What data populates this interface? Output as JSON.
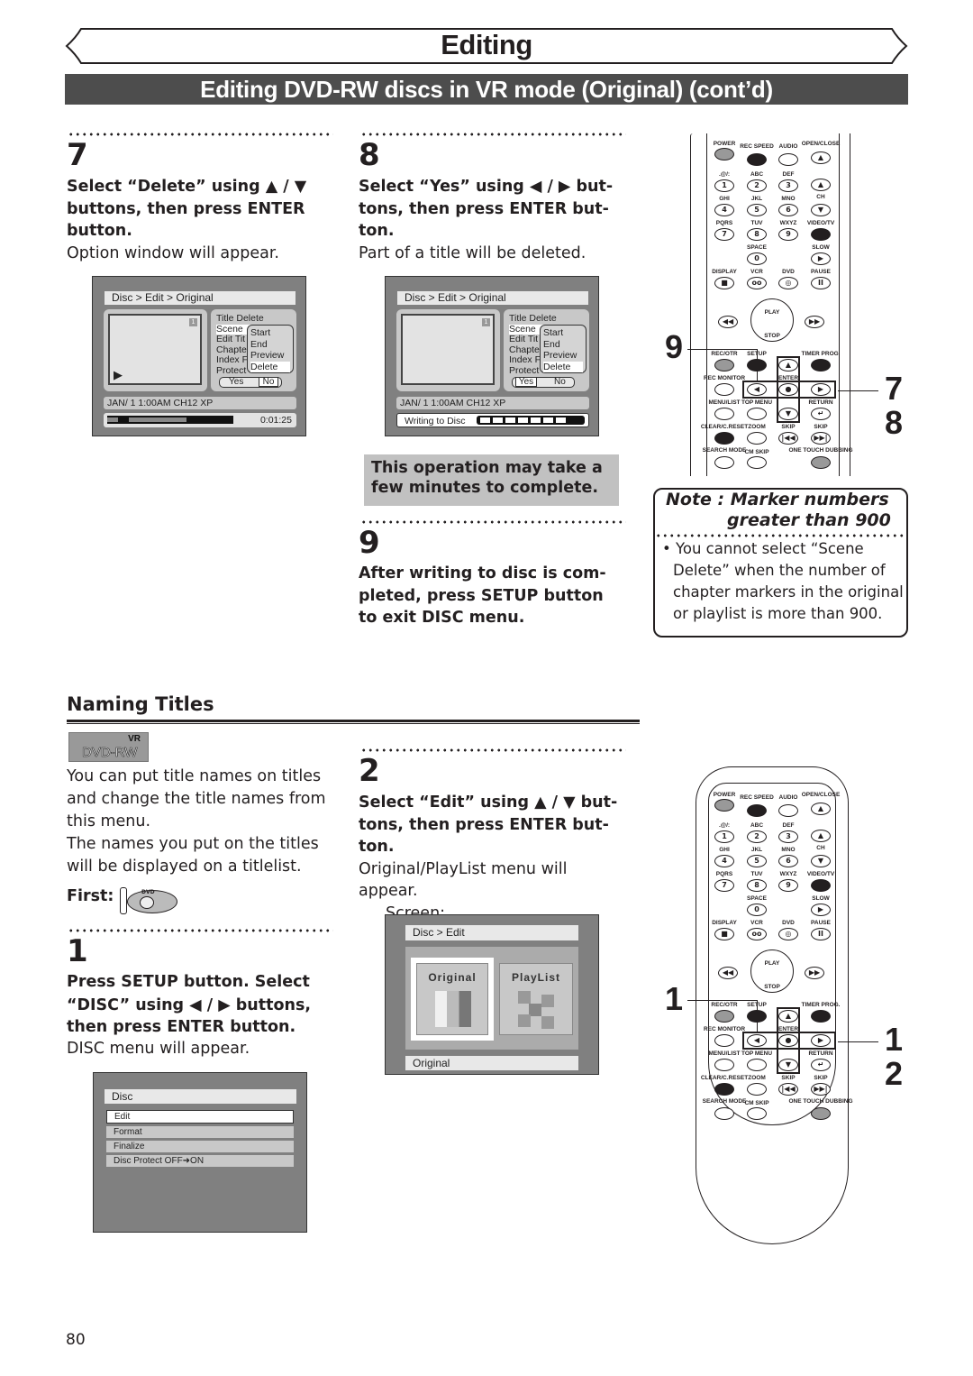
{
  "header": {
    "title": "Editing",
    "subtitle": "Editing DVD-RW discs in VR mode (Original) (cont’d)"
  },
  "steps_top": [
    {
      "number": "7",
      "instruction_lines": [
        "Select “Delete” using ▲ / ▼",
        "buttons, then press ENTER",
        "button."
      ],
      "result": "Option window will appear.",
      "screen": {
        "breadcrumb": "Disc > Edit > Original",
        "thumb_badge": "1",
        "menu_items": [
          "Title Delete",
          "Scene",
          "Edit Tit",
          "Chapte",
          "Index F",
          "Protect"
        ],
        "popup_items": [
          "Start",
          "End",
          "Preview",
          "Delete"
        ],
        "popup_selected": "Delete",
        "confirm": {
          "yes": "Yes",
          "no": "No",
          "selected": "No"
        },
        "info_line": "JAN/ 1   1:00AM  CH12    XP",
        "timecode": "0:01:25",
        "play_icon": "play-icon"
      }
    },
    {
      "number": "8",
      "instruction_lines": [
        "Select “Yes” using ◀ / ▶ but-",
        "tons, then press ENTER but-",
        "ton."
      ],
      "result": "Part of a title will be deleted.",
      "screen": {
        "breadcrumb": "Disc > Edit > Original",
        "thumb_badge": "1",
        "menu_items": [
          "Title Delete",
          "Scene",
          "Edit Tit",
          "Chapte",
          "Index F",
          "Protect"
        ],
        "popup_items": [
          "Start",
          "End",
          "Preview",
          "Delete"
        ],
        "popup_selected": "Delete",
        "confirm": {
          "yes": "Yes",
          "no": "No",
          "selected": "Yes"
        },
        "info_line": "JAN/ 1   1:00AM  CH12    XP",
        "status": "Writing to Disc",
        "progress_segments": 7
      },
      "callout_lines": [
        "This operation may take a",
        "few minutes to complete."
      ]
    },
    {
      "number": "9",
      "instruction_lines": [
        "After writing to disc is com-",
        "pleted, press SETUP button",
        "to exit DISC menu."
      ]
    }
  ],
  "note": {
    "title_line1": "Note : Marker numbers",
    "title_line2": "greater than 900",
    "body_lines": [
      "• You cannot select “Scene",
      "Delete” when the number of",
      "chapter markers in the original",
      "or playlist is more than 900."
    ]
  },
  "remote": {
    "row_labels": {
      "top": [
        "POWER",
        "REC SPEED",
        "AUDIO",
        "OPEN/CLOSE"
      ],
      "r1": [
        ".@/:",
        "ABC",
        "DEF"
      ],
      "r1_keys": [
        "1",
        "2",
        "3"
      ],
      "r2": [
        "GHI",
        "JKL",
        "MNO"
      ],
      "r2_keys": [
        "4",
        "5",
        "6"
      ],
      "ch": "CH",
      "r3": [
        "PQRS",
        "TUV",
        "WXYZ",
        "VIDEO/TV"
      ],
      "r3_keys": [
        "7",
        "8",
        "9"
      ],
      "space": "SPACE",
      "zero": "0",
      "slow": "SLOW",
      "r4": [
        "DISPLAY",
        "VCR",
        "DVD",
        "PAUSE"
      ],
      "play": "PLAY",
      "stop": "STOP",
      "r5": [
        "REC/OTR",
        "SETUP",
        "TIMER PROG."
      ],
      "rec_monitor": "REC MONITOR",
      "enter": "ENTER",
      "r6": [
        "MENU/LIST",
        "TOP MENU",
        "RETURN"
      ],
      "r7": [
        "CLEAR/C.RESET",
        "ZOOM",
        "SKIP",
        "SKIP"
      ],
      "r8": [
        "SEARCH MODE",
        "CM SKIP",
        "ONE TOUCH DUBBING"
      ]
    },
    "callouts_top": {
      "left": "9",
      "right": [
        "7",
        "8"
      ]
    },
    "callouts_bottom": {
      "left": "1",
      "right": [
        "1",
        "2"
      ]
    }
  },
  "naming": {
    "heading": "Naming Titles",
    "badge_top": "VR",
    "badge_bottom": "DVD-RW",
    "intro_lines": [
      "You can put title names on titles",
      "and change the title names from",
      "this menu.",
      "The names you put on the titles",
      "will be displayed on a titlelist."
    ],
    "first_label": "First:",
    "first_icon_text": "DVD",
    "steps": [
      {
        "number": "1",
        "instruction_lines": [
          "Press SETUP button. Select",
          "“DISC” using ◀ / ▶ buttons,",
          "then press ENTER button."
        ],
        "result": "DISC menu will appear.",
        "screen": {
          "title": "Disc",
          "items": [
            "Edit",
            "Format",
            "Finalize",
            "Disc Protect OFF➜ON"
          ],
          "selected": "Edit"
        }
      },
      {
        "number": "2",
        "instruction_lines": [
          "Select “Edit” using ▲ / ▼ but-",
          "tons, then press ENTER but-",
          "ton."
        ],
        "result_lines": [
          "Original/PlayList menu will appear.",
          "Screen:"
        ],
        "screen": {
          "breadcrumb": "Disc > Edit",
          "tiles": [
            "Original",
            "PlayList"
          ],
          "selected": "Original",
          "footer": "Original"
        }
      }
    ]
  },
  "page_number": "80"
}
